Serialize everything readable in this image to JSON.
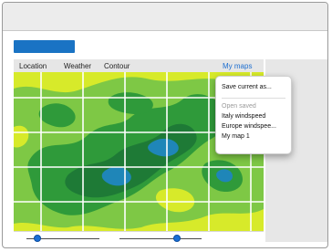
{
  "colors": {
    "accent": "#1a73c4",
    "menu_active": "#1e6fd0",
    "map_yellow": "#d7ea2a",
    "map_light_green": "#7ec845",
    "map_green": "#2f9a3a",
    "map_dark_green": "#1e7a36",
    "map_blue": "#1f86b8"
  },
  "menu": {
    "items": [
      {
        "label": "Location"
      },
      {
        "label": "Weather"
      },
      {
        "label": "Contour"
      },
      {
        "label": "My maps"
      }
    ]
  },
  "dropdown": {
    "save_label": "Save current as...",
    "section_header": "Open saved",
    "saved_maps": [
      "Italy windspeed",
      "Europe windspee...",
      "My map 1"
    ]
  },
  "sliders": [
    {
      "value": 0.15
    },
    {
      "value": 0.7
    }
  ]
}
